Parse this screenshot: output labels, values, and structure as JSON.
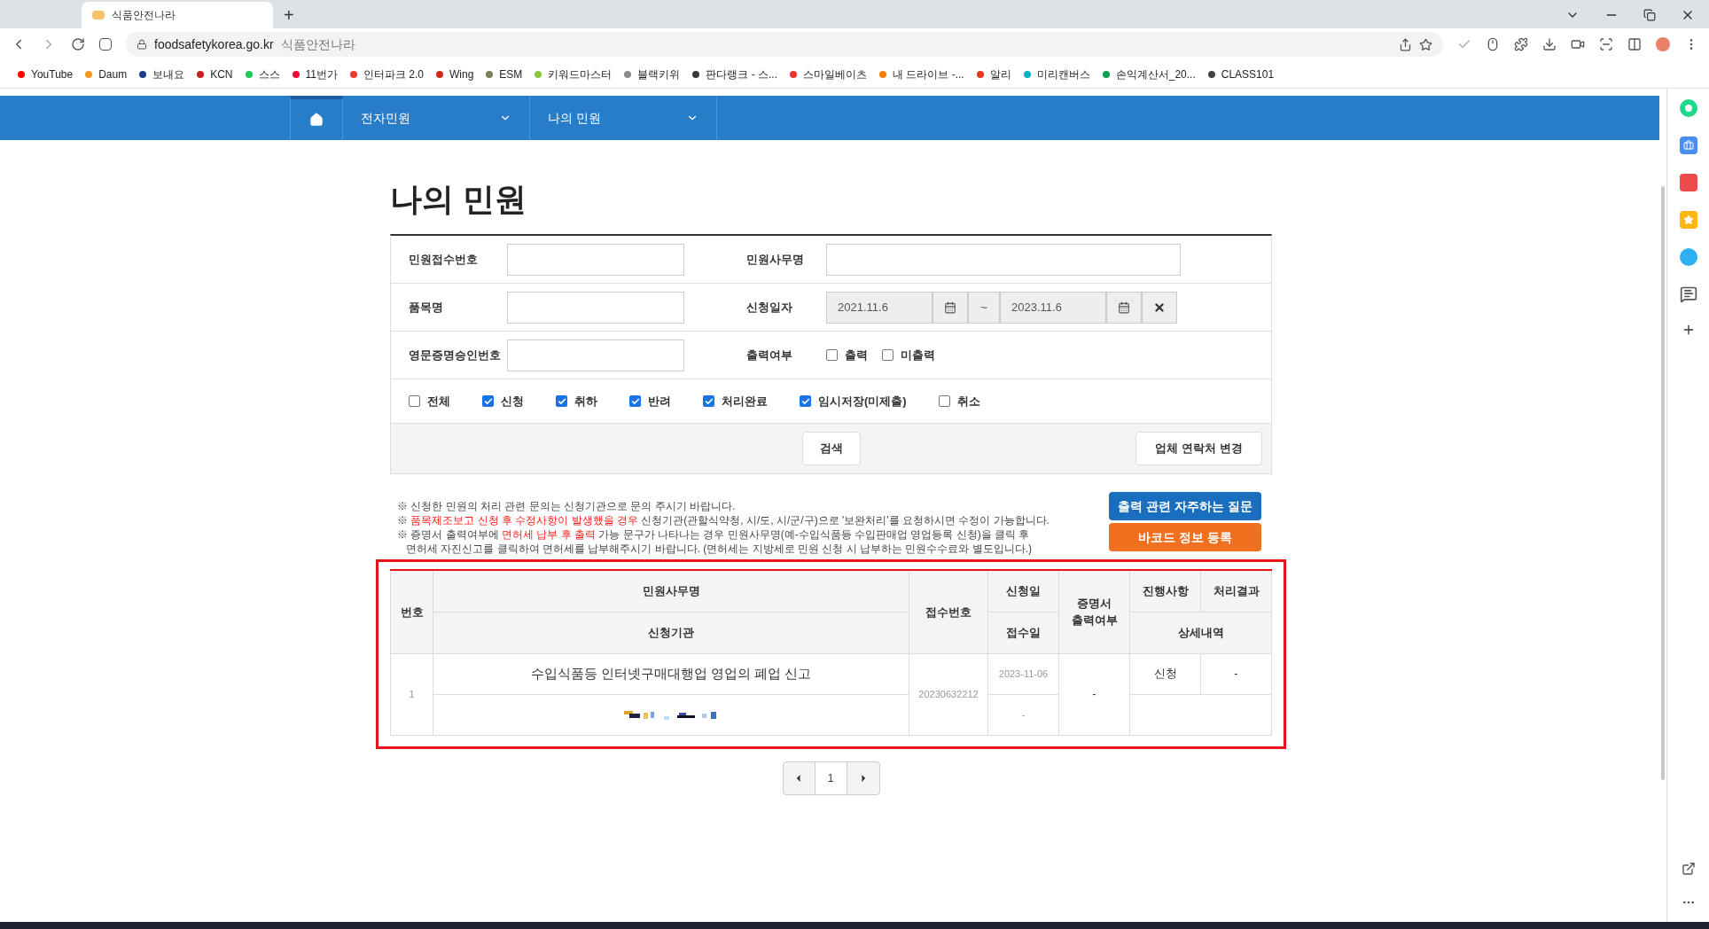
{
  "browser": {
    "tab_title": "식품안전나라",
    "new_tab": "+",
    "url": "foodsafetykorea.go.kr",
    "url_title": "식품안전나라",
    "bookmarks": [
      {
        "label": "YouTube",
        "color": "#ff0000"
      },
      {
        "label": "Daum",
        "color": "#f59a23"
      },
      {
        "label": "보내요",
        "color": "#1a3f8f"
      },
      {
        "label": "KCN",
        "color": "#cc1f1f"
      },
      {
        "label": "스스",
        "color": "#1ec85a"
      },
      {
        "label": "11번가",
        "color": "#f0093c"
      },
      {
        "label": "인터파크 2.0",
        "color": "#ef3b36"
      },
      {
        "label": "Wing",
        "color": "#cc2a1a"
      },
      {
        "label": "ESM",
        "color": "#7f7f5f"
      },
      {
        "label": "키워드마스터",
        "color": "#8cc63f"
      },
      {
        "label": "블랙키위",
        "color": "#8a8a8a"
      },
      {
        "label": "판다랭크 - 스...",
        "color": "#3a3a3a"
      },
      {
        "label": "스마일베이츠",
        "color": "#f03030"
      },
      {
        "label": "내 드라이브 -...",
        "color": "#f77f00"
      },
      {
        "label": "알리",
        "color": "#e8381a"
      },
      {
        "label": "미리캔버스",
        "color": "#00b4c8"
      },
      {
        "label": "손익계산서_20...",
        "color": "#10a050"
      },
      {
        "label": "CLASS101",
        "color": "#444444"
      }
    ]
  },
  "nav": {
    "items": [
      {
        "label": "전자민원"
      },
      {
        "label": "나의 민원"
      }
    ]
  },
  "page_title": "나의 민원",
  "form": {
    "receipt_label": "민원접수번호",
    "service_label": "민원사무명",
    "item_label": "품목명",
    "date_label": "신청일자",
    "date_from": "2021.11.6",
    "tilde": "~",
    "date_to": "2023.11.6",
    "cert_label": "영문증명승인번호",
    "print_label": "출력여부",
    "print_options": [
      {
        "label": "출력",
        "checked": false
      },
      {
        "label": "미출력",
        "checked": false
      }
    ],
    "status_filters": [
      {
        "label": "전체",
        "checked": false
      },
      {
        "label": "신청",
        "checked": true
      },
      {
        "label": "취하",
        "checked": true
      },
      {
        "label": "반려",
        "checked": true
      },
      {
        "label": "처리완료",
        "checked": true
      },
      {
        "label": "임시저장(미제출)",
        "checked": true
      },
      {
        "label": "취소",
        "checked": false
      }
    ],
    "search_button": "검색",
    "contact_button": "업체 연락처 변경"
  },
  "notes": [
    [
      {
        "kind": "plain",
        "text": "※ 신청한 민원의 처리 관련 문의는 신청기관으로 문의 주시기 바랍니다."
      }
    ],
    [
      {
        "kind": "plain",
        "text": "※ "
      },
      {
        "kind": "red",
        "text": "품목제조보고 신청 후 수정사항이 발생했을 경우"
      },
      {
        "kind": "plain",
        "text": " 신청기관(관할식약청, 시/도, 시/군/구)으로 '보완처리'를 요청하시면 수정이 가능합니다."
      }
    ],
    [
      {
        "kind": "plain",
        "text": "※ 증명서 출력여부에 "
      },
      {
        "kind": "red",
        "text": "면허세 납부 후 출력"
      },
      {
        "kind": "plain",
        "text": " 가능 문구가 나타나는 경우 민원사무명(예-수입식품등 수입판매업 영업등록 신청)을 클릭 후"
      }
    ],
    [
      {
        "kind": "plain",
        "text": "면허세 자진신고를 클릭하여 면허세를 납부해주시기 바랍니다. (면허세는 지방세로 민원 신청 시 납부하는 민원수수료와 별도입니다.)"
      }
    ]
  ],
  "faq_button": "출력 관련 자주하는 질문",
  "barcode_button": "바코드 정보 등록",
  "table": {
    "headers": {
      "no": "번호",
      "service": "민원사무명",
      "agency": "신청기관",
      "receipt": "접수번호",
      "apply_date": "신청일",
      "receive_date": "접수일",
      "cert": "증명서 출력여부",
      "progress": "진행사항",
      "result": "처리결과",
      "detail": "상세내역"
    },
    "rows": [
      {
        "no": "1",
        "service": "수입식품등 인터넷구매대행업 영업의 폐업 신고",
        "receipt": "20230632212",
        "apply_date": "2023-11-06",
        "receive_date": "-",
        "cert": "-",
        "progress": "신청",
        "result": "-"
      }
    ]
  },
  "pagination": {
    "pages": [
      {
        "label": "1",
        "selected": false
      }
    ]
  }
}
